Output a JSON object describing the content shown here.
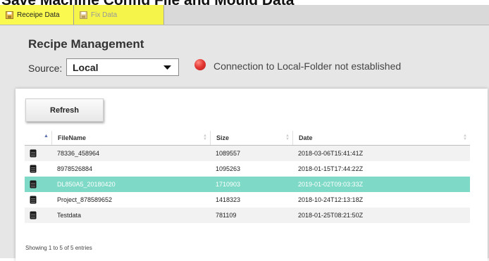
{
  "doc_title": "Save Machine Config File and Mould Data",
  "tabs": [
    {
      "label": "Receipe Data",
      "icon": "save-icon"
    },
    {
      "label": "Fix Data",
      "icon": "save-icon"
    }
  ],
  "recipe": {
    "heading": "Recipe Management",
    "source_label": "Source:",
    "source_value": "Local",
    "status": {
      "text": "Connection to Local-Folder not established",
      "color": "#e53935"
    }
  },
  "toolbar": {
    "refresh_label": "Refresh"
  },
  "table": {
    "columns": [
      "FileName",
      "Size",
      "Date"
    ],
    "sorted_column": "FileName",
    "rows": [
      {
        "filename": "78336_458964",
        "size": "1089557",
        "date": "2018-03-06T15:41:41Z"
      },
      {
        "filename": "8978526884",
        "size": "1095263",
        "date": "2018-01-15T17:44:22Z"
      },
      {
        "filename": "DL850A5_20180420",
        "size": "1710903",
        "date": "2019-01-02T09:03:33Z"
      },
      {
        "filename": "Project_878589652",
        "size": "1418323",
        "date": "2018-10-24T12:13:18Z"
      },
      {
        "filename": "Testdata",
        "size": "781109",
        "date": "2018-01-25T08:21:50Z"
      }
    ],
    "selected_row": 2,
    "selected_color": "#7ed9c6",
    "footer": "Showing 1 to 5 of 5 entries"
  },
  "colors": {
    "tab_highlight": "#ffff00",
    "panel": "#e6e6e6"
  }
}
